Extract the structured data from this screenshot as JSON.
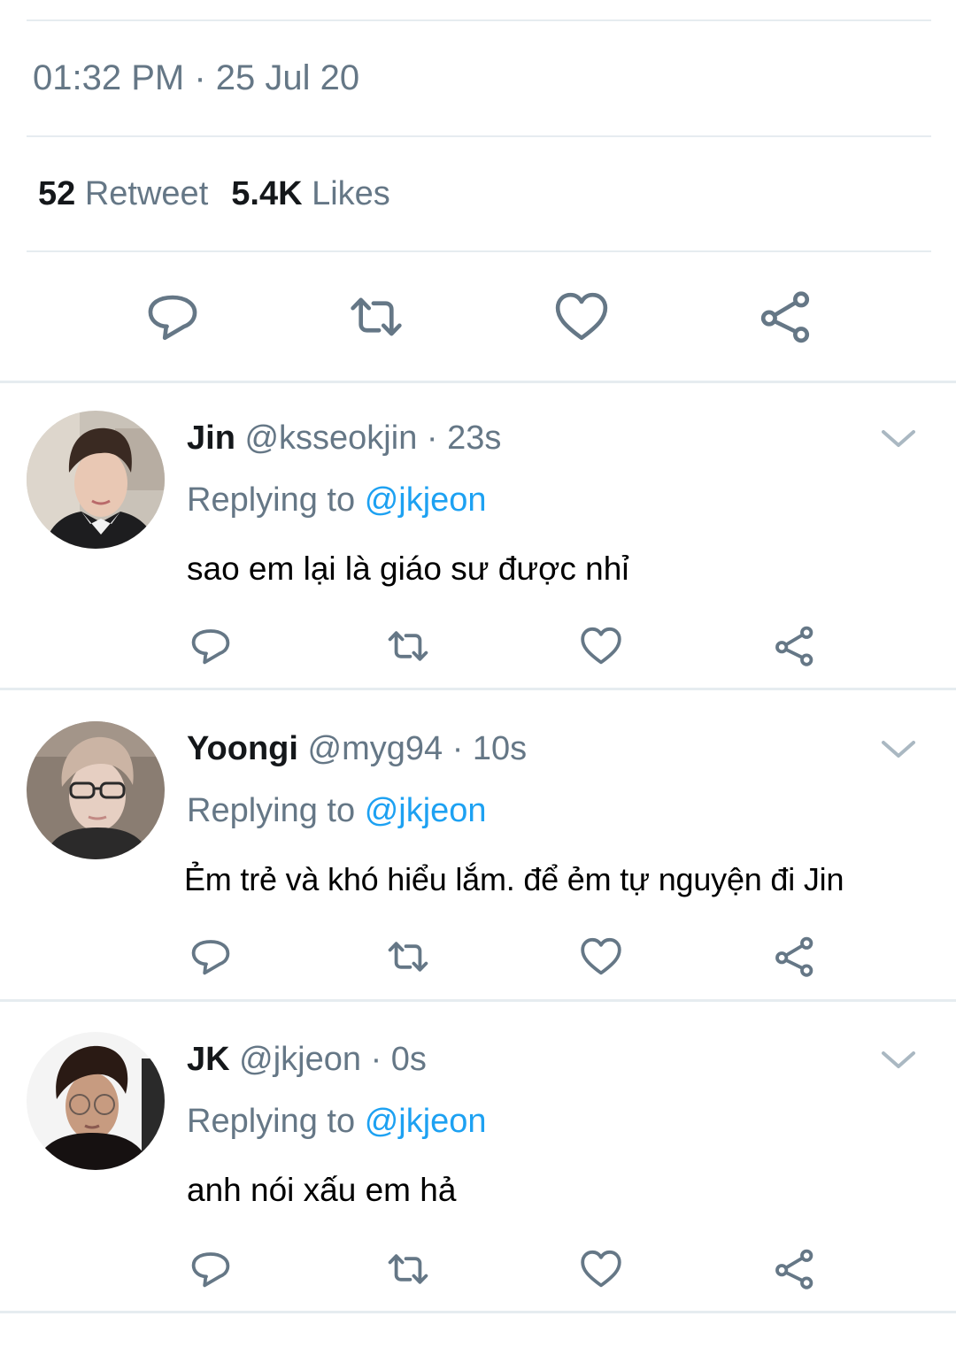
{
  "tweet": {
    "timestamp": "01:32 PM · 25 Jul 20",
    "retweet_count": "52",
    "retweet_label": "Retweet",
    "likes_count": "5.4K",
    "likes_label": "Likes"
  },
  "actions": {
    "reply_icon": "speech-bubble-icon",
    "retweet_icon": "retweet-arrows-icon",
    "like_icon": "heart-icon",
    "share_icon": "share-nodes-icon"
  },
  "colors": {
    "text_primary": "#14171a",
    "text_secondary": "#657786",
    "mention": "#1da1f2",
    "divider": "#e6ecf0"
  },
  "replies": [
    {
      "name": "Jin",
      "handle": "@ksseokjin",
      "time": "· 23s",
      "replying_label": "Replying to",
      "replying_to": "@jkjeon",
      "text": "sao em lại là giáo sư được nhỉ"
    },
    {
      "name": "Yoongi",
      "handle": "@myg94",
      "time": "· 10s",
      "replying_label": "Replying to",
      "replying_to": "@jkjeon",
      "text": "Ẻm trẻ và khó hiểu lắm. để ẻm tự nguyện đi Jin"
    },
    {
      "name": "JK",
      "handle": "@jkjeon",
      "time": "· 0s",
      "replying_label": "Replying to",
      "replying_to": "@jkjeon",
      "text": "anh nói xấu em hả"
    }
  ]
}
